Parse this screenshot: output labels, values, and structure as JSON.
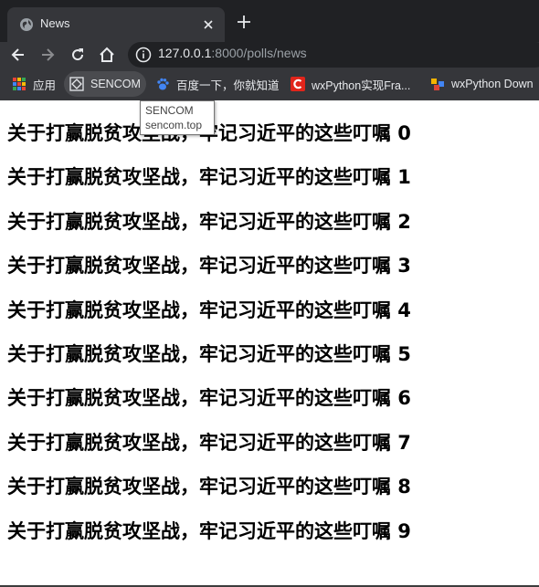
{
  "browser": {
    "tab_title": "News",
    "url_host": "127.0.0.1",
    "url_rest": ":8000/polls/news",
    "bookmarks": [
      {
        "label": "应用",
        "icon": "apps-grid-icon"
      },
      {
        "label": "SENCOM",
        "icon": "sencom-icon"
      },
      {
        "label": "百度一下，你就知道",
        "icon": "baidu-paw-icon"
      },
      {
        "label": "wxPython实现Fra...",
        "icon": "csdn-c-icon"
      },
      {
        "label": "wxPython Down",
        "icon": "wxpython-icon"
      }
    ],
    "tooltip": {
      "title": "SENCOM",
      "url": "sencom.top"
    }
  },
  "news": {
    "items": [
      "关于打赢脱贫攻坚战，牢记习近平的这些叮嘱 0",
      "关于打赢脱贫攻坚战，牢记习近平的这些叮嘱 1",
      "关于打赢脱贫攻坚战，牢记习近平的这些叮嘱 2",
      "关于打赢脱贫攻坚战，牢记习近平的这些叮嘱 3",
      "关于打赢脱贫攻坚战，牢记习近平的这些叮嘱 4",
      "关于打赢脱贫攻坚战，牢记习近平的这些叮嘱 5",
      "关于打赢脱贫攻坚战，牢记习近平的这些叮嘱 6",
      "关于打赢脱贫攻坚战，牢记习近平的这些叮嘱 7",
      "关于打赢脱贫攻坚战，牢记习近平的这些叮嘱 8",
      "关于打赢脱贫攻坚战，牢记习近平的这些叮嘱 9"
    ]
  }
}
